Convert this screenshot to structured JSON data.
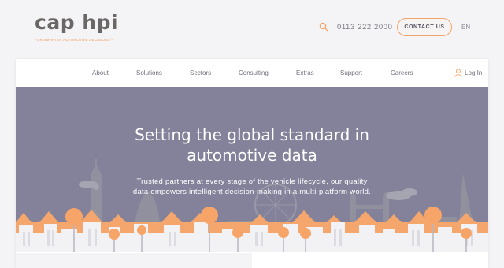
{
  "header": {
    "logo_text": "cap hpi",
    "logo_tagline": "FOR SMARTER AUTOMOTIVE DECISIONS™",
    "phone": "0113 222 2000",
    "contact_label": "CONTACT US",
    "language": "EN",
    "accent_color": "#f5a46a"
  },
  "nav": {
    "items": [
      "About",
      "Solutions",
      "Sectors",
      "Consulting",
      "Extras",
      "Support",
      "Careers"
    ],
    "login_label": "Log In"
  },
  "hero": {
    "title_line1": "Setting the global standard in",
    "title_line2": "automotive data",
    "subtitle_line1": "Trusted partners at every stage of the vehicle lifecycle, our quality",
    "subtitle_line2": "data empowers intelligent decision-making in a multi-platform world.",
    "background_color": "#83829a"
  },
  "icons": {
    "search": "search-icon",
    "user": "user-icon"
  }
}
